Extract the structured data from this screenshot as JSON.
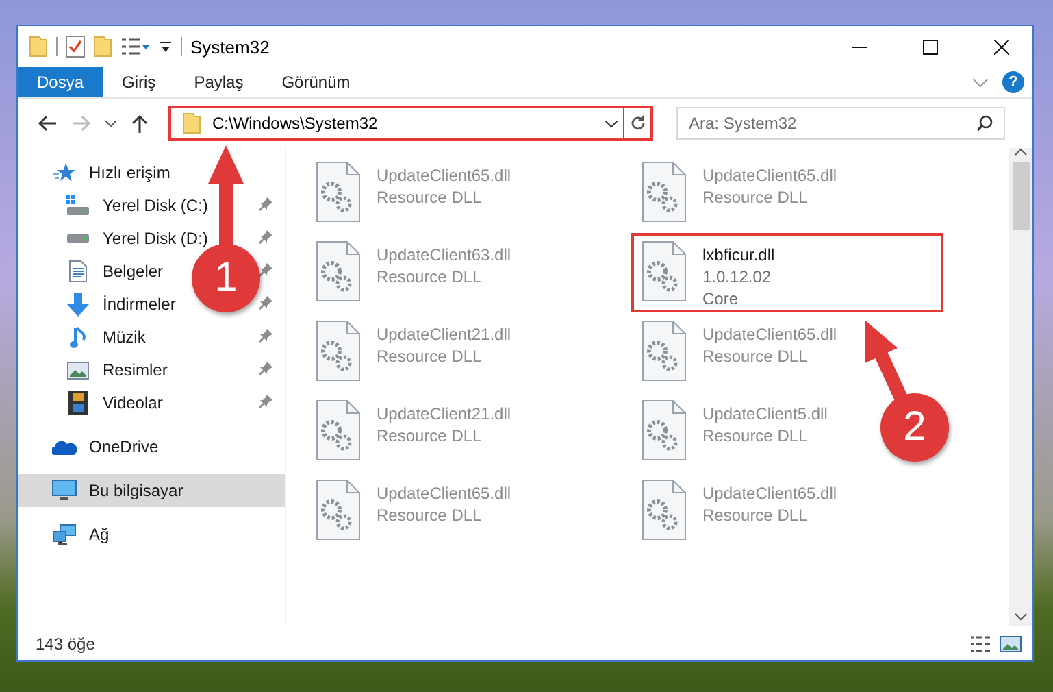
{
  "window": {
    "title": "System32"
  },
  "ribbon_tabs": [
    {
      "label": "Dosya",
      "kind": "file",
      "selected": false
    },
    {
      "label": "Giriş",
      "kind": "tab",
      "selected": false
    },
    {
      "label": "Paylaş",
      "kind": "tab",
      "selected": false
    },
    {
      "label": "Görünüm",
      "kind": "tab",
      "selected": false
    }
  ],
  "help_button": "?",
  "address_bar": {
    "path": "C:\\Windows\\System32",
    "highlighted": true
  },
  "search": {
    "placeholder": "Ara: System32"
  },
  "nav": [
    {
      "label": "Hızlı erişim",
      "selected": false,
      "children": [
        {
          "label": "Yerel Disk (C:)",
          "pinned": true,
          "selected": false
        },
        {
          "label": "Yerel Disk (D:)",
          "pinned": true,
          "selected": false
        },
        {
          "label": "Belgeler",
          "pinned": true,
          "selected": false
        },
        {
          "label": "İndirmeler",
          "pinned": true,
          "selected": false
        },
        {
          "label": "Müzik",
          "pinned": true,
          "selected": false
        },
        {
          "label": "Resimler",
          "pinned": true,
          "selected": false
        },
        {
          "label": "Videolar",
          "pinned": true,
          "selected": false
        }
      ]
    },
    {
      "label": "OneDrive",
      "selected": false
    },
    {
      "label": "Bu bilgisayar",
      "selected": true
    },
    {
      "label": "Ağ",
      "selected": false
    }
  ],
  "files": [
    {
      "name": "UpdateClient65.dll",
      "details": [
        "Resource DLL"
      ],
      "outlined": false
    },
    {
      "name": "UpdateClient65.dll",
      "details": [
        "Resource DLL"
      ],
      "outlined": false
    },
    {
      "name": "UpdateClient63.dll",
      "details": [
        "Resource DLL"
      ],
      "outlined": false
    },
    {
      "name": "lxbficur.dll",
      "details": [
        "1.0.12.02",
        "Core"
      ],
      "outlined": true
    },
    {
      "name": "UpdateClient21.dll",
      "details": [
        "Resource DLL"
      ],
      "outlined": false
    },
    {
      "name": "UpdateClient65.dll",
      "details": [
        "Resource DLL"
      ],
      "outlined": false
    },
    {
      "name": "UpdateClient21.dll",
      "details": [
        "Resource DLL"
      ],
      "outlined": false
    },
    {
      "name": "UpdateClient5.dll",
      "details": [
        "Resource DLL"
      ],
      "outlined": false
    },
    {
      "name": "UpdateClient65.dll",
      "details": [
        "Resource DLL"
      ],
      "outlined": false
    },
    {
      "name": "UpdateClient65.dll",
      "details": [
        "Resource DLL"
      ],
      "outlined": false
    }
  ],
  "status_bar": {
    "item_count": "143 öğe"
  },
  "annotations": [
    {
      "number": "1"
    },
    {
      "number": "2"
    }
  ]
}
